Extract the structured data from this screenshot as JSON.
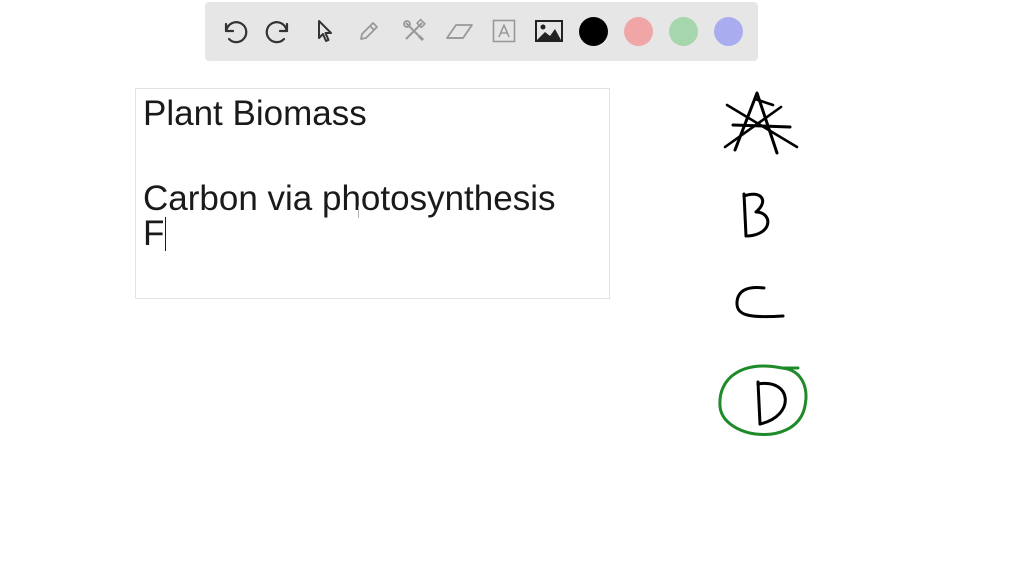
{
  "toolbar": {
    "tools": [
      {
        "icon": "undo-icon"
      },
      {
        "icon": "redo-icon"
      },
      {
        "icon": "pointer-icon"
      },
      {
        "icon": "pen-icon"
      },
      {
        "icon": "tools-icon"
      },
      {
        "icon": "eraser-icon"
      },
      {
        "icon": "text-icon"
      },
      {
        "icon": "image-icon"
      }
    ],
    "colors": [
      "#000000",
      "#f0a6a6",
      "#a6d6ac",
      "#a9adf0"
    ],
    "selected_color": "#000000"
  },
  "textbox": {
    "line1": "Plant Biomass",
    "line2": "Carbon via photosynthesis",
    "line3": "F"
  },
  "handwriting": {
    "options": [
      "A",
      "B",
      "C",
      "D"
    ],
    "crossed_out": "A",
    "circled": "D",
    "circle_color": "#1f8a2a"
  }
}
